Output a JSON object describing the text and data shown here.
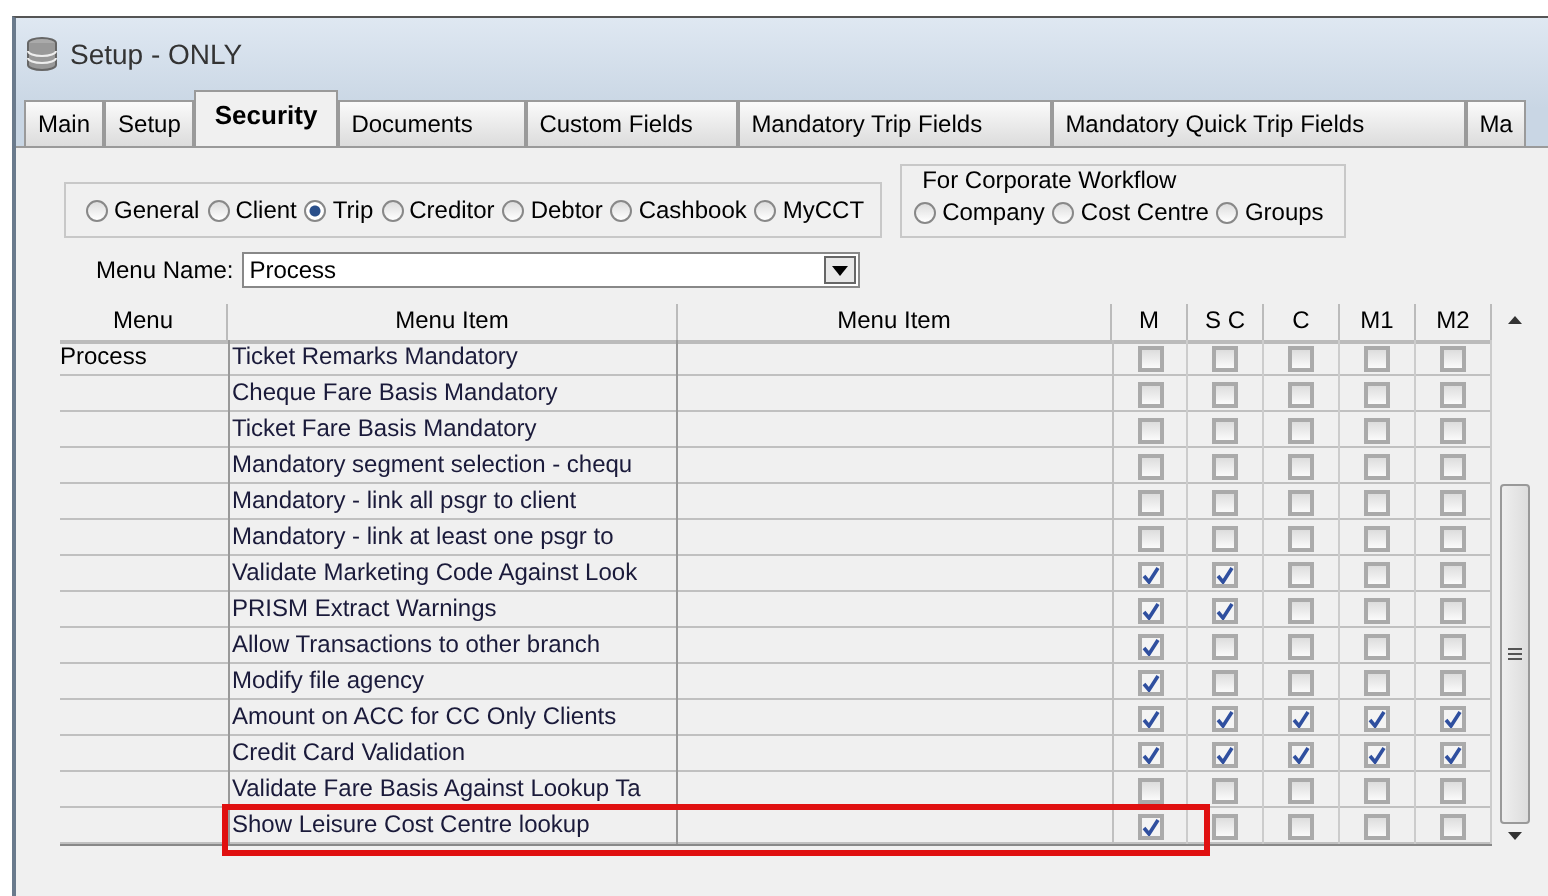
{
  "window": {
    "title": "Setup - ONLY"
  },
  "tabs": [
    {
      "label": "Main",
      "selected": false
    },
    {
      "label": "Setup",
      "selected": false
    },
    {
      "label": "Security",
      "selected": true
    },
    {
      "label": "Documents",
      "selected": false
    },
    {
      "label": "Custom Fields",
      "selected": false
    },
    {
      "label": "Mandatory Trip Fields",
      "selected": false
    },
    {
      "label": "Mandatory Quick Trip Fields",
      "selected": false
    },
    {
      "label": "Ma",
      "selected": false
    }
  ],
  "scope_options": [
    {
      "label": "General",
      "selected": false
    },
    {
      "label": "Client",
      "selected": false
    },
    {
      "label": "Trip",
      "selected": true
    },
    {
      "label": "Creditor",
      "selected": false
    },
    {
      "label": "Debtor",
      "selected": false
    },
    {
      "label": "Cashbook",
      "selected": false
    },
    {
      "label": "MyCCT",
      "selected": false
    }
  ],
  "corporate_workflow": {
    "title": "For Corporate Workflow",
    "options": [
      {
        "label": "Company",
        "selected": false
      },
      {
        "label": "Cost Centre",
        "selected": false
      },
      {
        "label": "Groups",
        "selected": false
      }
    ]
  },
  "menu_name": {
    "label": "Menu Name:",
    "value": "Process"
  },
  "table": {
    "columns": [
      "Menu",
      "Menu Item",
      "Menu Item",
      "M",
      "S C",
      "C",
      "M1",
      "M2"
    ],
    "rows": [
      {
        "menu": "Process",
        "item": "Ticket Remarks Mandatory",
        "checks": [
          false,
          false,
          false,
          false,
          false
        ],
        "highlighted": false
      },
      {
        "item": "Cheque Fare Basis Mandatory",
        "checks": [
          false,
          false,
          false,
          false,
          false
        ],
        "highlighted": false
      },
      {
        "item": "Ticket Fare Basis Mandatory",
        "checks": [
          false,
          false,
          false,
          false,
          false
        ],
        "highlighted": false
      },
      {
        "item": "Mandatory segment selection - chequ",
        "checks": [
          false,
          false,
          false,
          false,
          false
        ],
        "highlighted": false
      },
      {
        "item": "Mandatory - link all psgr to client",
        "checks": [
          false,
          false,
          false,
          false,
          false
        ],
        "highlighted": false
      },
      {
        "item": "Mandatory - link at least one psgr to",
        "checks": [
          false,
          false,
          false,
          false,
          false
        ],
        "highlighted": false
      },
      {
        "item": "Validate Marketing Code Against Look",
        "checks": [
          true,
          true,
          false,
          false,
          false
        ],
        "highlighted": false
      },
      {
        "item": "PRISM Extract Warnings",
        "checks": [
          true,
          true,
          false,
          false,
          false
        ],
        "highlighted": false
      },
      {
        "item": "Allow Transactions to other branch",
        "checks": [
          true,
          false,
          false,
          false,
          false
        ],
        "highlighted": false
      },
      {
        "item": "Modify file agency",
        "checks": [
          true,
          false,
          false,
          false,
          false
        ],
        "highlighted": false
      },
      {
        "item": "Amount on ACC for CC Only Clients",
        "checks": [
          true,
          true,
          true,
          true,
          true
        ],
        "highlighted": false
      },
      {
        "item": "Credit Card Validation",
        "checks": [
          true,
          true,
          true,
          true,
          true
        ],
        "highlighted": false
      },
      {
        "item": "Validate Fare Basis Against Lookup Ta",
        "checks": [
          false,
          false,
          false,
          false,
          false
        ],
        "highlighted": false
      },
      {
        "item": "Show Leisure Cost Centre lookup",
        "checks": [
          true,
          false,
          false,
          false,
          false
        ],
        "highlighted": true
      }
    ]
  }
}
